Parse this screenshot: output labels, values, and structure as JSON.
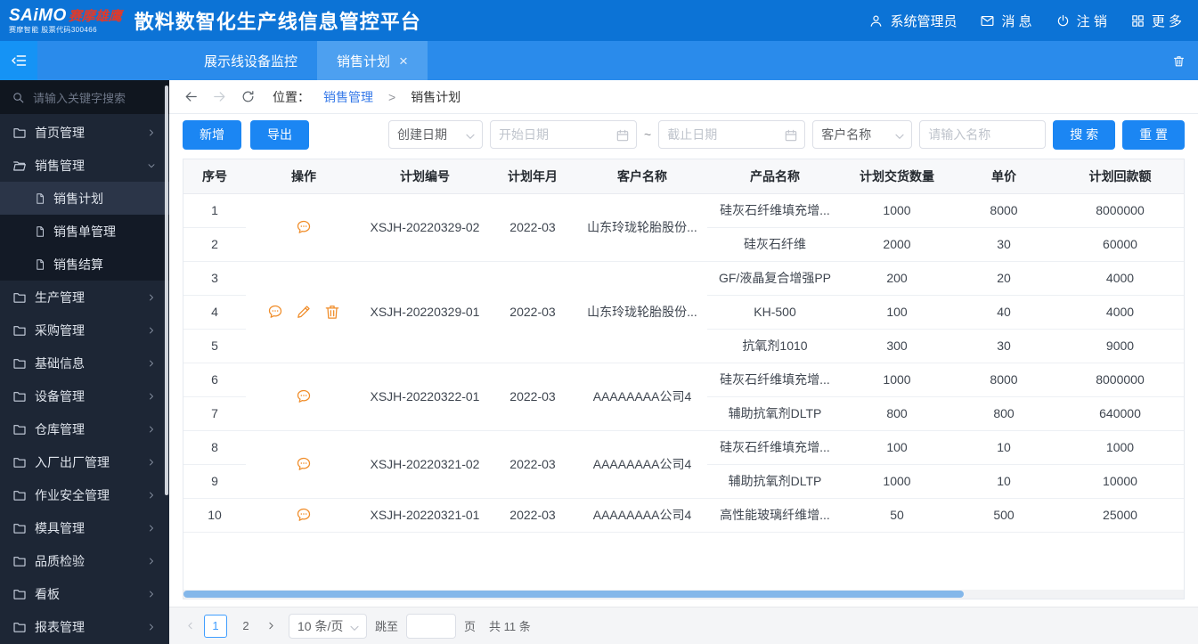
{
  "colors": {
    "accent_blue": "#1b86f3",
    "header_blue": "#0c73d6",
    "tabbar_blue": "#2a8beb",
    "active_tab_blue": "#4da0f0",
    "sidebar_bg": "#1d2635",
    "action_orange": "#f08c28",
    "scroll_thumb_blue": "#83b7ea",
    "link_blue": "#3579e8",
    "logo_red": "#e03a2a"
  },
  "header": {
    "logo": {
      "en": "SAiMO",
      "cn": "赛摩雄鹰",
      "sub": "赛摩智能 股票代码300466"
    },
    "title": "散料数智化生产线信息管控平台",
    "user": "系统管理员",
    "messages": "消 息",
    "logout": "注 销",
    "more": "更 多"
  },
  "tabbar": {
    "tabs": [
      {
        "label": "展示线设备监控",
        "active": false,
        "closable": false
      },
      {
        "label": "销售计划",
        "active": true,
        "closable": true
      }
    ]
  },
  "sidebar": {
    "search_placeholder": "请输入关键字搜索",
    "items": [
      {
        "label": "首页管理",
        "expanded": false
      },
      {
        "label": "销售管理",
        "expanded": true,
        "children": [
          {
            "label": "销售计划",
            "active": true
          },
          {
            "label": "销售单管理",
            "active": false
          },
          {
            "label": "销售结算",
            "active": false
          }
        ]
      },
      {
        "label": "生产管理",
        "expanded": false
      },
      {
        "label": "采购管理",
        "expanded": false
      },
      {
        "label": "基础信息",
        "expanded": false
      },
      {
        "label": "设备管理",
        "expanded": false
      },
      {
        "label": "仓库管理",
        "expanded": false
      },
      {
        "label": "入厂出厂管理",
        "expanded": false
      },
      {
        "label": "作业安全管理",
        "expanded": false
      },
      {
        "label": "模具管理",
        "expanded": false
      },
      {
        "label": "品质检验",
        "expanded": false
      },
      {
        "label": "看板",
        "expanded": false
      },
      {
        "label": "报表管理",
        "expanded": false
      }
    ]
  },
  "breadcrumb": {
    "location_label": "位置：",
    "parent": "销售管理",
    "separator": ">",
    "current": "销售计划"
  },
  "toolbar": {
    "add": "新增",
    "export": "导出",
    "date_type": "创建日期",
    "start_placeholder": "开始日期",
    "tilde": "~",
    "end_placeholder": "截止日期",
    "filter_field": "客户名称",
    "name_placeholder": "请输入名称",
    "search": "搜 索",
    "reset": "重 置"
  },
  "table": {
    "headers": [
      "序号",
      "操作",
      "计划编号",
      "计划年月",
      "客户名称",
      "产品名称",
      "计划交货数量",
      "单价",
      "计划回款额"
    ],
    "groups": [
      {
        "plan_no": "XSJH-20220329-02",
        "month": "2022-03",
        "customer": "山东玲珑轮胎股份...",
        "actions": [
          "comment"
        ],
        "rows": [
          {
            "no": "1",
            "product": "硅灰石纤维填充增...",
            "qty": "1000",
            "price": "8000",
            "amount": "8000000"
          },
          {
            "no": "2",
            "product": "硅灰石纤维",
            "qty": "2000",
            "price": "30",
            "amount": "60000"
          }
        ]
      },
      {
        "plan_no": "XSJH-20220329-01",
        "month": "2022-03",
        "customer": "山东玲珑轮胎股份...",
        "actions": [
          "comment",
          "edit",
          "trash"
        ],
        "rows": [
          {
            "no": "3",
            "product": "GF/液晶复合增强PP",
            "qty": "200",
            "price": "20",
            "amount": "4000"
          },
          {
            "no": "4",
            "product": "KH-500",
            "qty": "100",
            "price": "40",
            "amount": "4000"
          },
          {
            "no": "5",
            "product": "抗氧剂1010",
            "qty": "300",
            "price": "30",
            "amount": "9000"
          }
        ]
      },
      {
        "plan_no": "XSJH-20220322-01",
        "month": "2022-03",
        "customer": "AAAAAAAA公司4",
        "actions": [
          "comment"
        ],
        "rows": [
          {
            "no": "6",
            "product": "硅灰石纤维填充增...",
            "qty": "1000",
            "price": "8000",
            "amount": "8000000"
          },
          {
            "no": "7",
            "product": "辅助抗氧剂DLTP",
            "qty": "800",
            "price": "800",
            "amount": "640000"
          }
        ]
      },
      {
        "plan_no": "XSJH-20220321-02",
        "month": "2022-03",
        "customer": "AAAAAAAA公司4",
        "actions": [
          "comment"
        ],
        "rows": [
          {
            "no": "8",
            "product": "硅灰石纤维填充增...",
            "qty": "100",
            "price": "10",
            "amount": "1000"
          },
          {
            "no": "9",
            "product": "辅助抗氧剂DLTP",
            "qty": "1000",
            "price": "10",
            "amount": "10000"
          }
        ]
      },
      {
        "plan_no": "XSJH-20220321-01",
        "month": "2022-03",
        "customer": "AAAAAAAA公司4",
        "actions": [
          "comment"
        ],
        "rows": [
          {
            "no": "10",
            "product": "高性能玻璃纤维增...",
            "qty": "50",
            "price": "500",
            "amount": "25000"
          }
        ]
      }
    ]
  },
  "pagination": {
    "pages": [
      {
        "label": "1",
        "active": true
      },
      {
        "label": "2",
        "active": false
      }
    ],
    "page_size": "10 条/页",
    "jump_label": "跳至",
    "page_unit": "页",
    "total": "共 11 条"
  }
}
